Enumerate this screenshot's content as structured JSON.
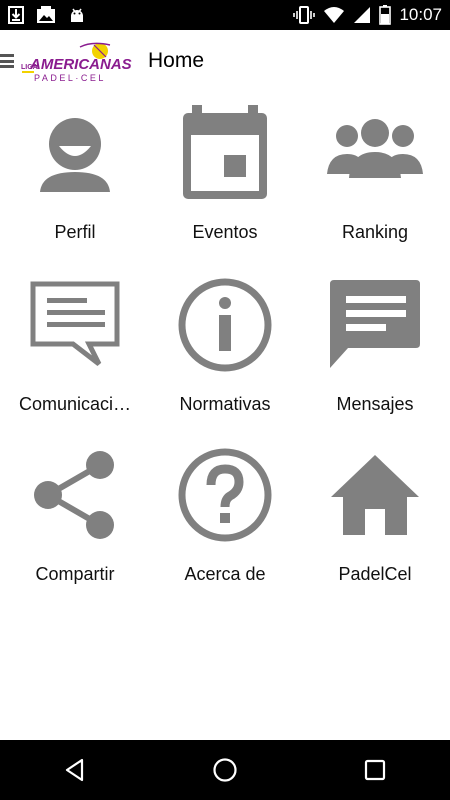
{
  "status_bar": {
    "time": "10:07",
    "left_icons": [
      "download-icon",
      "photo-icon",
      "android-icon"
    ],
    "right_icons": [
      "vibrate-icon",
      "wifi-icon",
      "signal-icon",
      "battery-icon"
    ]
  },
  "app_bar": {
    "title": "Home",
    "logo_text": "AMERICANAS",
    "logo_subtext": "PADEL·CEL",
    "logo_small": "LIGA",
    "brand_color": "#8a1c8f",
    "accent_color": "#f2d200"
  },
  "menu": [
    {
      "label": "Perfil",
      "icon": "person-icon"
    },
    {
      "label": "Eventos",
      "icon": "calendar-icon"
    },
    {
      "label": "Ranking",
      "icon": "group-icon"
    },
    {
      "label": "Comunicaci…",
      "icon": "announcement-icon"
    },
    {
      "label": "Normativas",
      "icon": "info-icon"
    },
    {
      "label": "Mensajes",
      "icon": "message-icon"
    },
    {
      "label": "Compartir",
      "icon": "share-icon"
    },
    {
      "label": "Acerca de",
      "icon": "help-icon"
    },
    {
      "label": "PadelCel",
      "icon": "home-icon"
    }
  ],
  "colors": {
    "icon_gray": "#808080",
    "status_bar": "#000000",
    "nav_bar": "#000000"
  },
  "nav_bar": {
    "buttons": [
      "back-icon",
      "home-circle-icon",
      "recents-icon"
    ]
  }
}
